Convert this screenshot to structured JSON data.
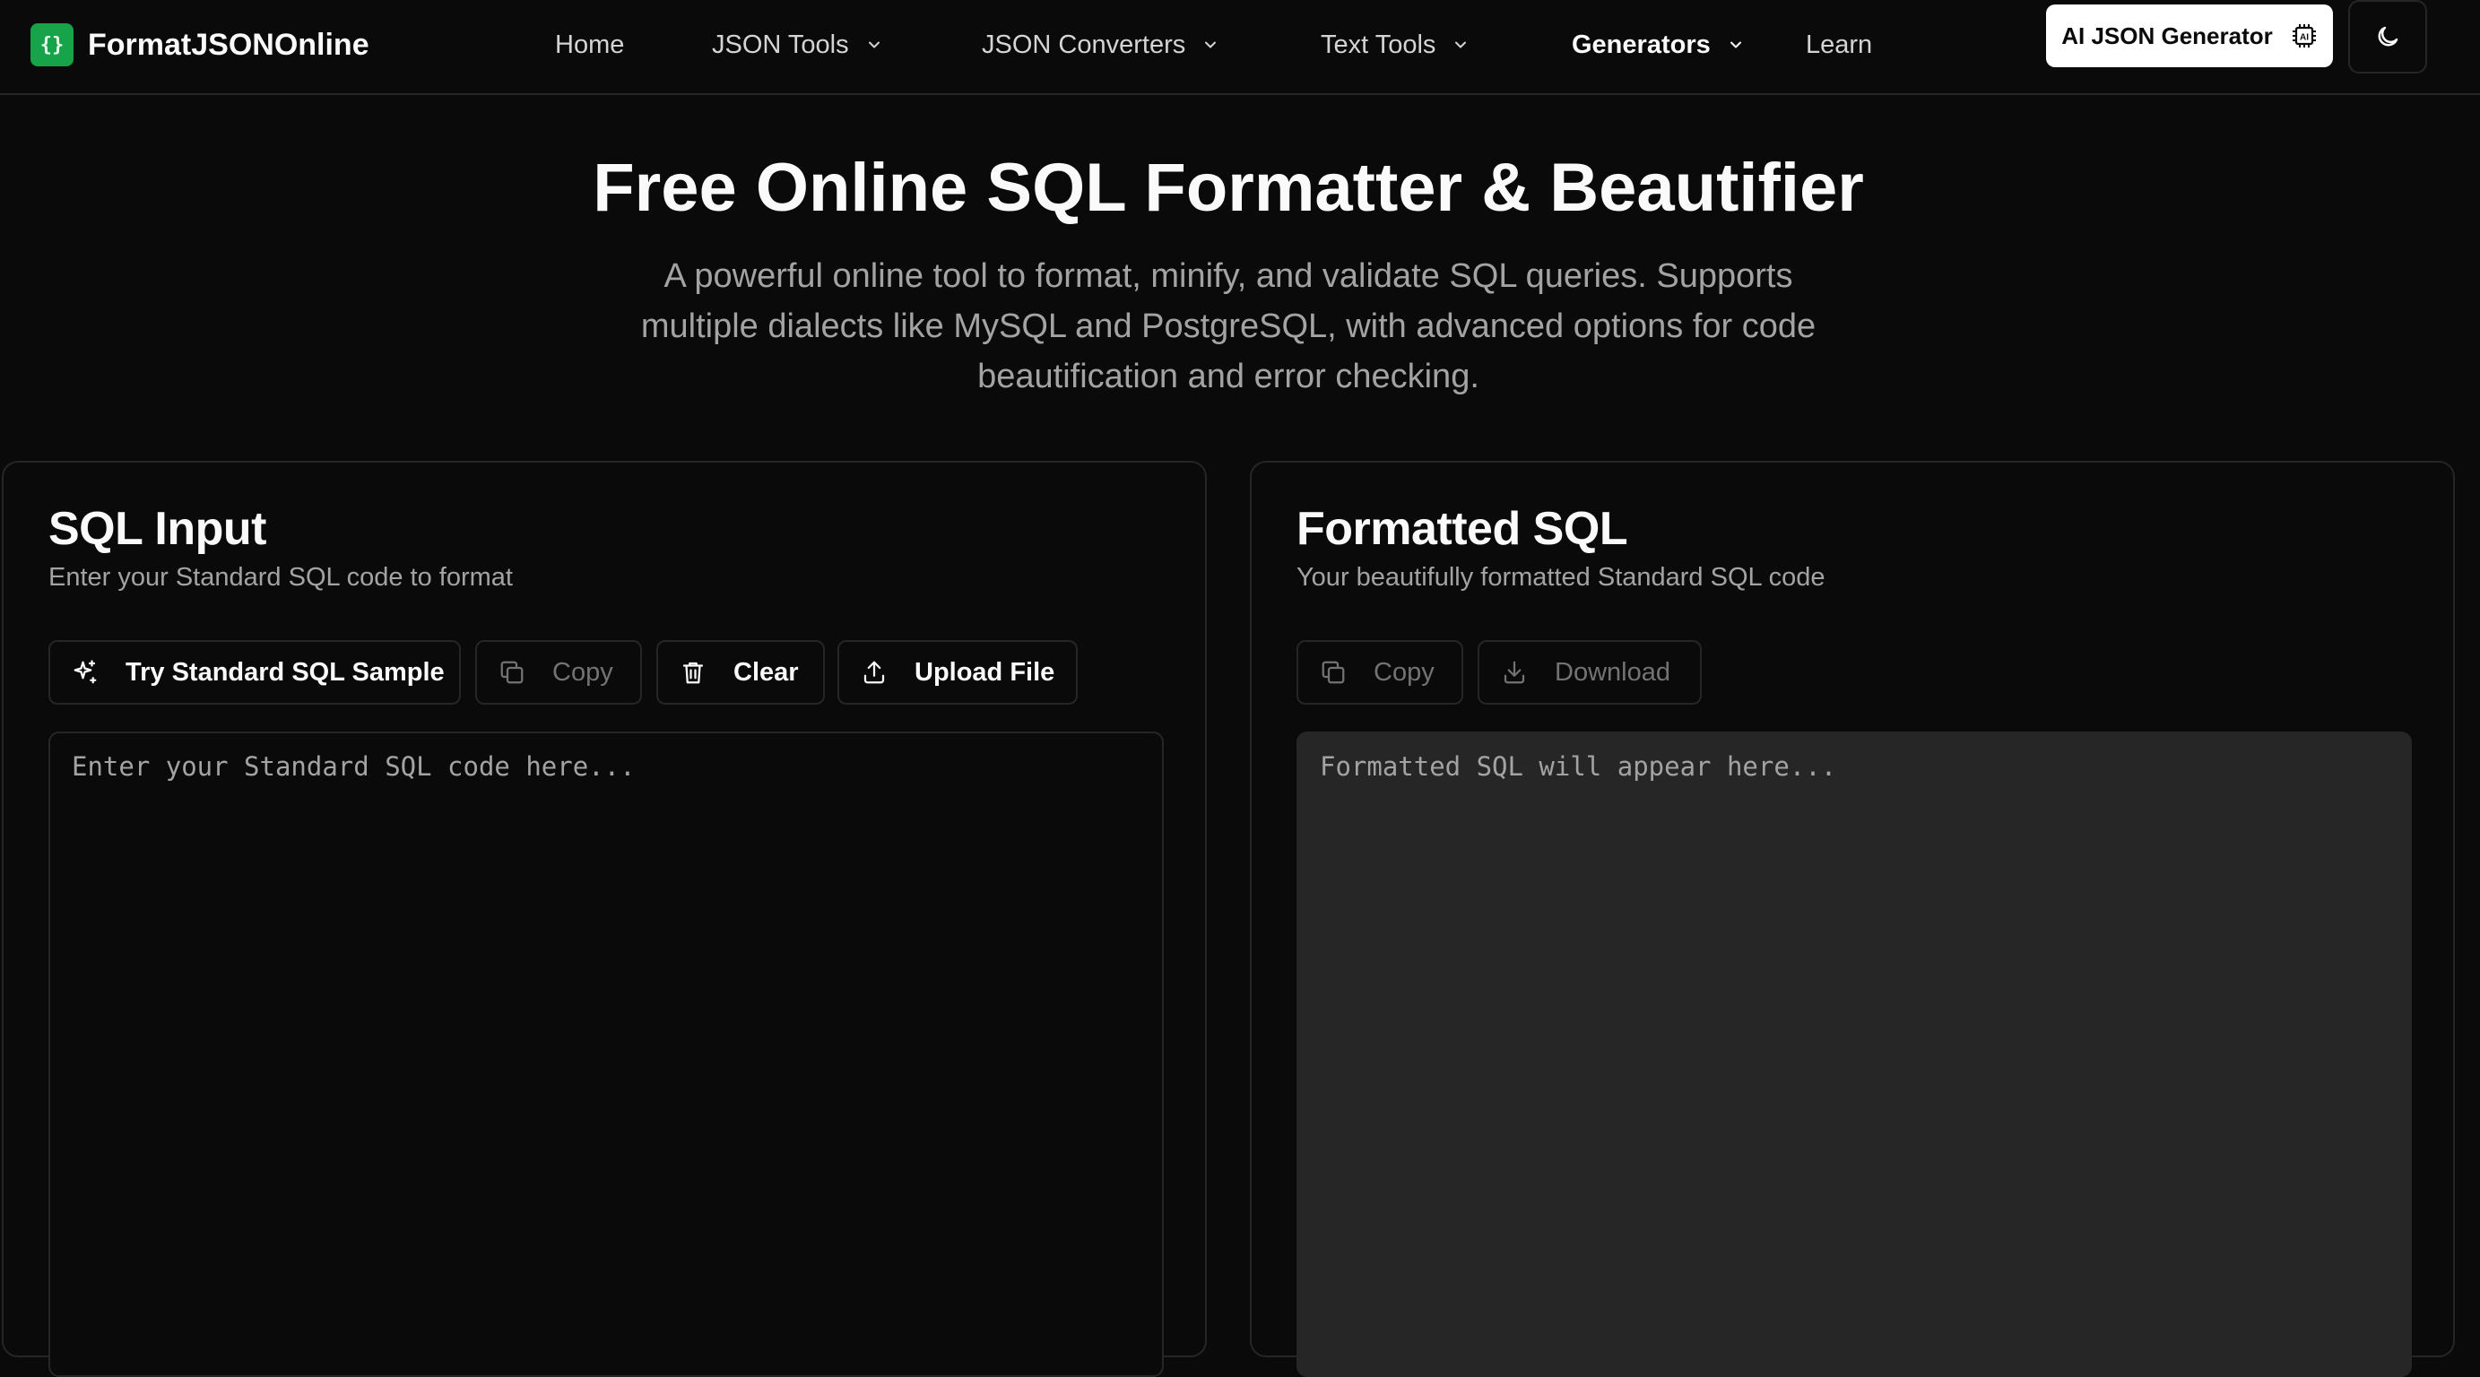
{
  "brand": {
    "logo_glyph": "{}",
    "name": "FormatJSONOnline",
    "accent": "#16a34a"
  },
  "nav": {
    "items": [
      {
        "label": "Home"
      },
      {
        "label": "JSON Tools"
      },
      {
        "label": "JSON Converters"
      },
      {
        "label": "Text Tools"
      },
      {
        "label": "Generators"
      },
      {
        "label": "Learn"
      }
    ],
    "ai_button": "AI JSON Generator",
    "theme_icon": "moon-icon"
  },
  "hero": {
    "title": "Free Online SQL Formatter & Beautifier",
    "subtitle": "A powerful online tool to format, minify, and validate SQL queries. Supports multiple dialects like MySQL and PostgreSQL, with advanced options for code beautification and error checking."
  },
  "input_panel": {
    "title": "SQL Input",
    "description": "Enter your Standard SQL code to format",
    "buttons": {
      "sample": "Try Standard SQL Sample",
      "copy": "Copy",
      "clear": "Clear",
      "upload": "Upload File"
    },
    "placeholder": "Enter your Standard SQL code here..."
  },
  "output_panel": {
    "title": "Formatted SQL",
    "description": "Your beautifully formatted Standard SQL code",
    "buttons": {
      "copy": "Copy",
      "download": "Download"
    },
    "placeholder": "Formatted SQL will appear here..."
  }
}
